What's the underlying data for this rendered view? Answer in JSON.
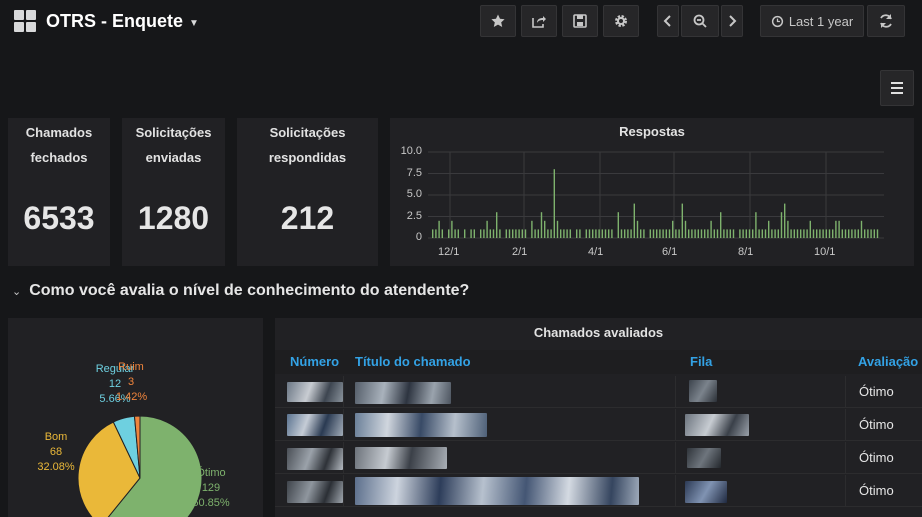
{
  "header": {
    "title": "OTRS - Enquete",
    "time_range": "Last 1 year"
  },
  "stats": [
    {
      "title_line1": "Chamados",
      "title_line2": "fechados",
      "value": "6533"
    },
    {
      "title_line1": "Solicitações",
      "title_line2": "enviadas",
      "value": "1280"
    },
    {
      "title_line1": "Solicitações",
      "title_line2": "respondidas",
      "value": "212"
    }
  ],
  "graph": {
    "title": "Respostas",
    "chart_data": {
      "type": "bar",
      "title": "Respostas",
      "ylim": [
        0,
        10
      ],
      "yticks": [
        "10.0",
        "7.5",
        "5.0",
        "2.5",
        "0"
      ],
      "xticks": [
        "12/1",
        "2/1",
        "4/1",
        "6/1",
        "8/1",
        "10/1"
      ],
      "color": "#7eb26d",
      "values": [
        1,
        1,
        2,
        1,
        0,
        1,
        2,
        1,
        1,
        0,
        1,
        0,
        1,
        1,
        0,
        1,
        1,
        2,
        1,
        1,
        3,
        1,
        0,
        1,
        1,
        1,
        1,
        1,
        1,
        1,
        0,
        2,
        1,
        1,
        3,
        2,
        1,
        1,
        8,
        2,
        1,
        1,
        1,
        1,
        0,
        1,
        1,
        0,
        1,
        1,
        1,
        1,
        1,
        1,
        1,
        1,
        1,
        0,
        3,
        1,
        1,
        1,
        1,
        4,
        2,
        1,
        1,
        0,
        1,
        1,
        1,
        1,
        1,
        1,
        1,
        2,
        1,
        1,
        4,
        2,
        1,
        1,
        1,
        1,
        1,
        1,
        1,
        2,
        1,
        1,
        3,
        1,
        1,
        1,
        1,
        0,
        1,
        1,
        1,
        1,
        1,
        3,
        1,
        1,
        1,
        2,
        1,
        1,
        1,
        3,
        4,
        2,
        1,
        1,
        1,
        1,
        1,
        1,
        2,
        1,
        1,
        1,
        1,
        1,
        1,
        1,
        2,
        2,
        1,
        1,
        1,
        1,
        1,
        1,
        2,
        1,
        1,
        1,
        1,
        1
      ]
    }
  },
  "section": {
    "title": "Como você avalia o nível de conhecimento do atendente?"
  },
  "pie": {
    "chart_data": {
      "type": "pie",
      "slices": [
        {
          "label": "Ótimo",
          "count": "129",
          "percent": "60.85%",
          "value": 129,
          "color": "#7eb26d"
        },
        {
          "label": "Bom",
          "count": "68",
          "percent": "32.08%",
          "value": 68,
          "color": "#eab839"
        },
        {
          "label": "Regular",
          "count": "12",
          "percent": "5.66%",
          "value": 12,
          "color": "#6ed0e0"
        },
        {
          "label": "Ruim",
          "count": "3",
          "percent": "1.42%",
          "value": 3,
          "color": "#ef843c"
        }
      ]
    }
  },
  "table": {
    "title": "Chamados avaliados",
    "columns": [
      "Número",
      "Título do chamado",
      "Fila",
      "Avaliação"
    ],
    "rows": [
      {
        "rating": "Ótimo"
      },
      {
        "rating": "Ótimo"
      },
      {
        "rating": "Ótimo"
      },
      {
        "rating": "Ótimo"
      }
    ]
  }
}
